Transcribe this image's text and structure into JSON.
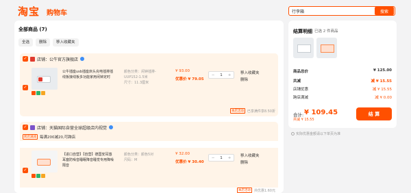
{
  "header": {
    "logo": "淘宝",
    "subtitle": "购物车",
    "search_value": "行李箱",
    "search_button": "搜索"
  },
  "cart": {
    "title": "全部商品 (7)",
    "toolbar": [
      "全选",
      "删除",
      "移入收藏夹"
    ],
    "shops": [
      {
        "name": "店铺：公牛官方旗舰店",
        "items": [
          {
            "title": "公牛插座usb插座床头充电插排插线板接线板多功能家用闲钟定时",
            "spec1": "颜色分类：闲钟插排-UUP152-1.5米",
            "spec2": "尺寸：11.3厘米",
            "price": "¥ 93.00",
            "price_discount": "优惠价 ¥ 79.05",
            "qty": "1",
            "action1": "移入收藏夹",
            "action2": "删除"
          }
        ],
        "footer_tag": "本店活动",
        "footer_text": "已享满件享8.50折"
      },
      {
        "name": "店铺：天猫国际自营全球超级店内视觉",
        "promo_tag": "跨店满减",
        "promo_text": "每满200减20,可跨店",
        "items": [
          {
            "title": "【进口自营】【自营】德国安耳悠耳塞防噪音睡眠降音睡觉专用降噪隔音",
            "spec1": "颜色分类：颜色5对",
            "spec2": "尺码：M",
            "price": "¥ 32.00",
            "price_discount": "优惠价 ¥ 30.40",
            "qty": "1",
            "action1": "移入收藏夹",
            "action2": "删除"
          }
        ],
        "footer_tag": "本店活动",
        "footer_text": "共优惠1.60元"
      }
    ]
  },
  "summary": {
    "title": "结算明细",
    "selected": "已选 2 件商品",
    "rows": [
      {
        "label": "商品总价",
        "value": "¥ 125.00",
        "accent": false
      },
      {
        "label": "共减",
        "value": "减 ¥ 15.55",
        "accent": true
      },
      {
        "label": "店铺优惠",
        "value": "减 ¥ 15.55",
        "accent": true
      },
      {
        "label": "跨店满减",
        "value": "减 ¥ 0.00",
        "accent": true
      }
    ],
    "total_label": "合计:",
    "total_value": "¥ 109.45",
    "total_sub": "共减 ¥ 15.55",
    "checkout": "结 算"
  },
  "note": "实际优惠金额请以下单页为准",
  "colors": {
    "accent": "#ff5000",
    "light": "#fff4e8",
    "background": "#f3f3f4"
  }
}
